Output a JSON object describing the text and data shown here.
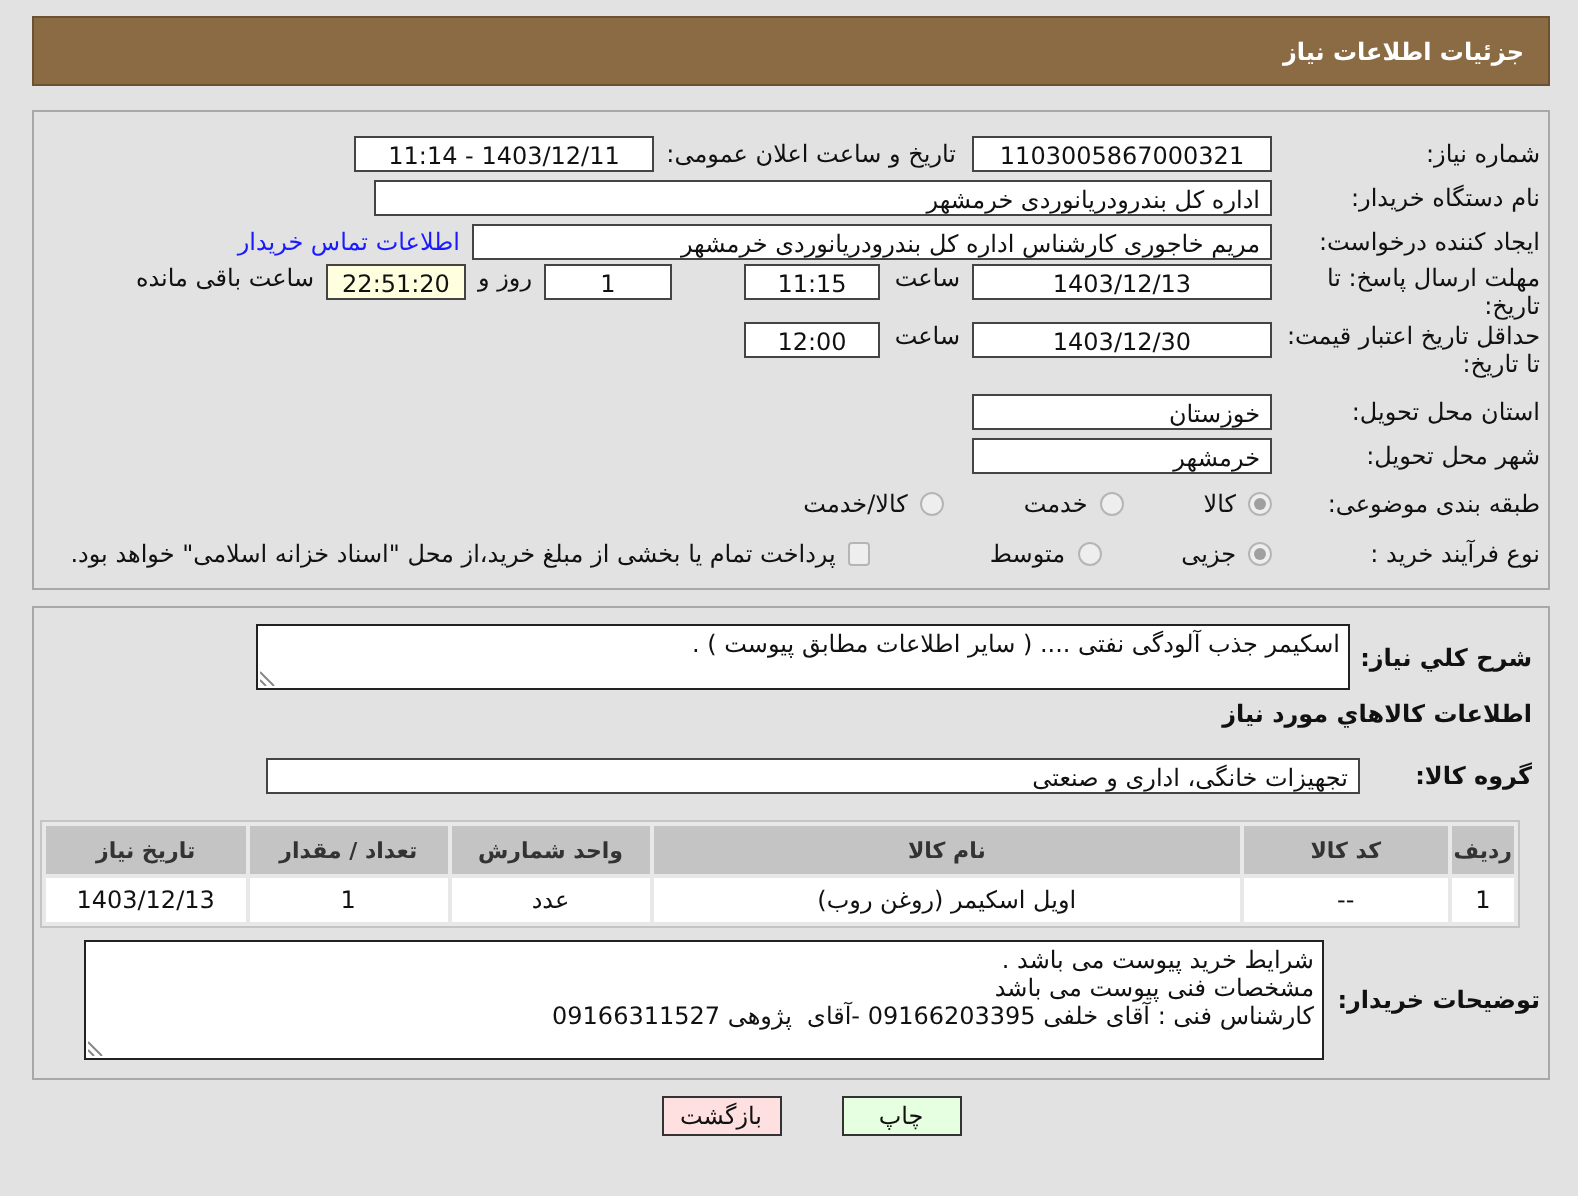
{
  "header": {
    "title": "جزئیات اطلاعات نیاز"
  },
  "need_number": {
    "label": "شماره نیاز:",
    "value": "1103005867000321"
  },
  "announce": {
    "label": "تاریخ و ساعت اعلان عمومی:",
    "value": "1403/12/11 - 11:14"
  },
  "buyer_org": {
    "label": "نام دستگاه خریدار:",
    "value": "اداره کل بندرودریانوردی خرمشهر"
  },
  "requester": {
    "label": "ایجاد کننده درخواست:",
    "value": "مریم خاجوری کارشناس اداره کل بندرودریانوردی خرمشهر",
    "link": "اطلاعات تماس خریدار"
  },
  "reply_deadline": {
    "label": "مهلت ارسال پاسخ: تا تاریخ:",
    "date": "1403/12/13",
    "time_label": "ساعت",
    "time": "11:15",
    "days": "1",
    "days_label": "روز و",
    "remaining": "22:51:20",
    "remaining_label": "ساعت باقی مانده"
  },
  "price_validity": {
    "label": "حداقل تاریخ اعتبار قیمت: تا تاریخ:",
    "date": "1403/12/30",
    "time_label": "ساعت",
    "time": "12:00"
  },
  "province": {
    "label": "استان محل تحویل:",
    "value": "خوزستان"
  },
  "city": {
    "label": "شهر محل تحویل:",
    "value": "خرمشهر"
  },
  "category": {
    "label": "طبقه بندی موضوعی:",
    "options": [
      {
        "label": "کالا",
        "selected": true
      },
      {
        "label": "خدمت",
        "selected": false
      },
      {
        "label": "کالا/خدمت",
        "selected": false
      }
    ]
  },
  "process": {
    "label": "نوع فرآیند خرید :",
    "options": [
      {
        "label": "جزیی",
        "selected": true
      },
      {
        "label": "متوسط",
        "selected": false
      }
    ],
    "payment": {
      "label": "پرداخت تمام یا بخشی از مبلغ خرید،از محل \"اسناد خزانه اسلامی\" خواهد بود.",
      "checked": false
    }
  },
  "description": {
    "label": "شرح کلي نياز:",
    "value": "اسکیمر جذب آلودگی نفتی .... ( سایر اطلاعات مطابق پیوست ) ."
  },
  "goods_heading": "اطلاعات کالاهاي مورد نياز",
  "goods_group": {
    "label": "گروه کالا:",
    "value": "تجهیزات خانگی، اداری و صنعتی"
  },
  "table": {
    "columns": [
      "ردیف",
      "کد کالا",
      "نام کالا",
      "واحد شمارش",
      "تعداد / مقدار",
      "تاریخ نیاز"
    ],
    "rows": [
      [
        "1",
        "--",
        "اویل اسکیمر (روغن روب)",
        "عدد",
        "1",
        "1403/12/13"
      ]
    ]
  },
  "buyer_notes": {
    "label": "توضیحات خریدار:",
    "lines": [
      "شرایط خرید پیوست می باشد .",
      "مشخصات فنی پیوست می باشد",
      "کارشناس فنی : آقای خلفی 09166203395 -آقای  پژوهی 09166311527"
    ]
  },
  "buttons": [
    {
      "label": "چاپ",
      "kind": "print"
    },
    {
      "label": "بازگشت",
      "kind": "back"
    }
  ]
}
